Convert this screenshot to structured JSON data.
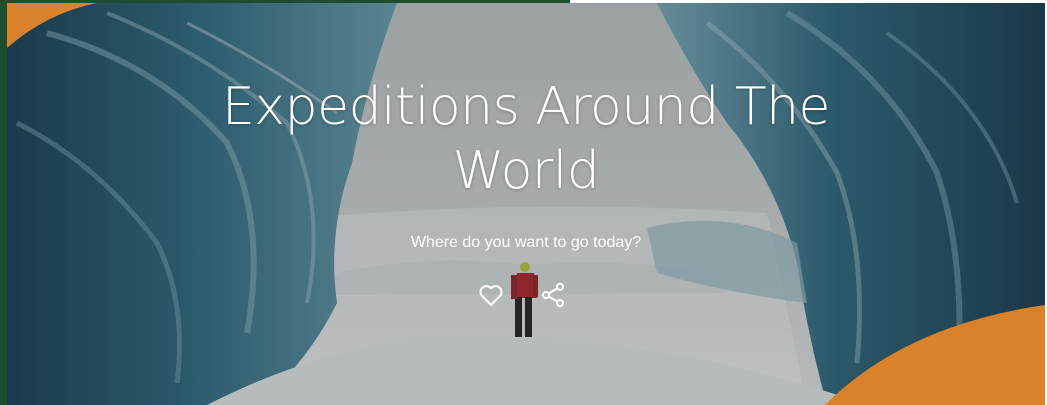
{
  "hero": {
    "title_line1": "Expeditions Around The",
    "title_line2": "World",
    "subtitle": "Where do you want to go today?",
    "actions": {
      "like_icon": "heart-outline-icon",
      "share_icon": "share-icon"
    }
  },
  "colors": {
    "accent_orange": "#d9822b",
    "frame_green": "#1d4d2c",
    "ice_blue": "#2f6f86",
    "text": "#ffffff"
  }
}
